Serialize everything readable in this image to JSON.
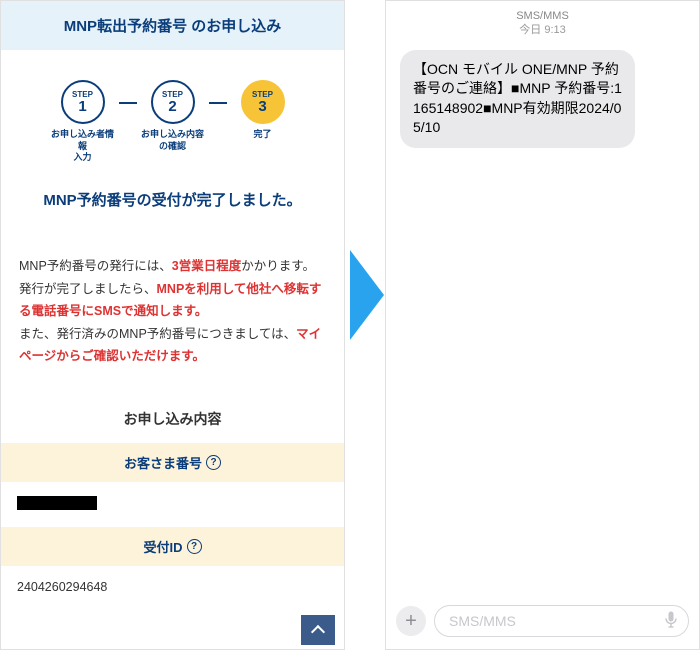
{
  "left": {
    "header": "MNP転出予約番号 のお申し込み",
    "steps": [
      {
        "label": "STEP",
        "num": "1",
        "caption": "お申し込み者情\n報\n入力",
        "active": false
      },
      {
        "label": "STEP",
        "num": "2",
        "caption": "お申し込み内容\nの確認",
        "active": false
      },
      {
        "label": "STEP",
        "num": "3",
        "caption": "完了",
        "active": true
      }
    ],
    "completion": "MNP予約番号の受付が完了しました。",
    "notice": {
      "p1a": "MNP予約番号の発行には、",
      "p1b": "3営業日程度",
      "p1c": "かかります。",
      "p2a": "発行が完了しましたら、",
      "p2b": "MNPを利用して他社へ移転する電話番号にSMSで通知します。",
      "p3a": "また、発行済みのMNP予約番号につきましては、",
      "p3b": "マイページからご確認いただけます。"
    },
    "section_title": "お申し込み内容",
    "fields": {
      "customer_label": "お客さま番号",
      "receipt_label": "受付ID",
      "receipt_value": "2404260294648"
    }
  },
  "sms": {
    "header_line1": "SMS/MMS",
    "header_line2": "今日 9:13",
    "bubble": "【OCN モバイル ONE/MNP 予約番号のご連絡】■MNP 予約番号:1165148902■MNP有効期限2024/05/10",
    "placeholder": "SMS/MMS"
  }
}
